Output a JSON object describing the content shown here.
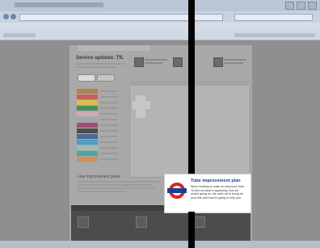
{
  "popup": {
    "title": "Tube improvement plan",
    "body": "We're working to make an improved Tube. To find out what's happening, find out what's going on, the work we're doing for your line and how it's going to help you.",
    "logo_colors": {
      "ring": "#dc241f",
      "bar": "#1c3f94"
    }
  },
  "page": {
    "heading": "Service updates: TfL"
  },
  "lower": {
    "title": "Line improvement plans"
  },
  "line_colors": [
    "#b36305",
    "#e32017",
    "#ffd300",
    "#00782a",
    "#f3a9bb",
    "#a0a5a9",
    "#9b0056",
    "#000000",
    "#003688",
    "#0098d4",
    "#95cdba",
    "#00a4a7",
    "#ee7c0e"
  ]
}
